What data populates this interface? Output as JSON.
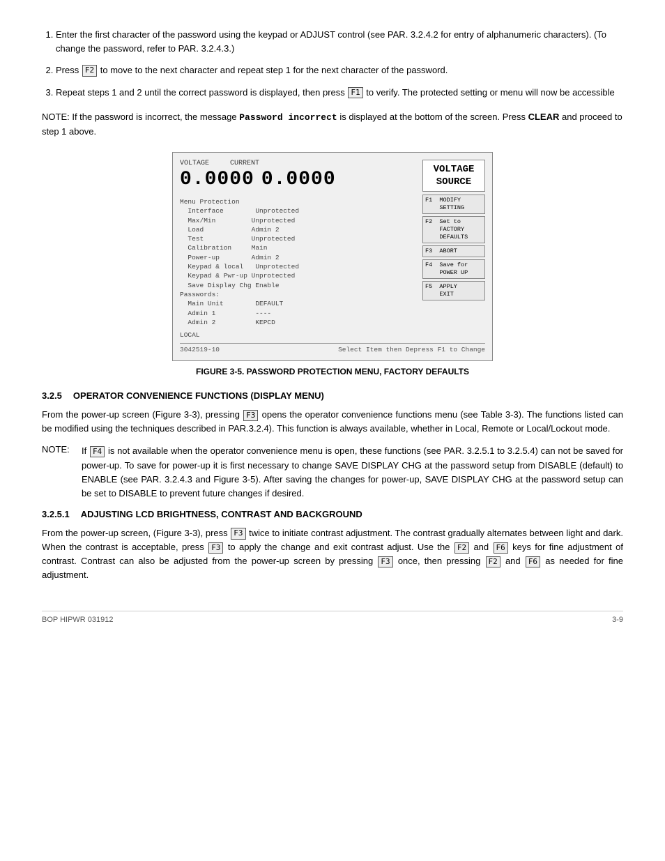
{
  "page": {
    "footer_left": "BOP HIPWR 031912",
    "footer_right": "3-9"
  },
  "steps": [
    {
      "number": "1",
      "text": "Enter the first character of the password using the keypad or ADJUST control (see PAR. 3.2.4.2 for entry of alphanumeric characters). (To change the password, refer to PAR. 3.2.4.3.)"
    },
    {
      "number": "2",
      "text_before": "Press",
      "key": "F2",
      "text_after": "to move to the next character and repeat step 1 for the next character of the password."
    },
    {
      "number": "3",
      "text_before": "Repeat steps 1 and 2 until the correct password is displayed, then press",
      "key": "F1",
      "text_after": "to verify. The protected setting or menu will now be accessible"
    }
  ],
  "note1": {
    "label": "NOTE:",
    "text_before": "If the password is incorrect, the message",
    "code": "Password  incorrect",
    "text_after": "is displayed at the bottom of the screen. Press",
    "bold": "CLEAR",
    "text_end": "and proceed to step 1 above."
  },
  "device": {
    "voltage_label": "VOLTAGE",
    "current_label": "CURRENT",
    "voltage_value": "0.0000",
    "current_value": "0.0000",
    "title": "VOLTAGE\nSOURCE",
    "menu_lines": [
      "Menu Protection",
      "  Interface        Unprotected",
      "  Max/Min          Unprotected",
      "  Load             Admin 2",
      "  Test             Unprotected",
      "  Calibration      Main",
      "  Power-up         Admin 2",
      "  Keypad & local   Unprotected",
      "  Keypad & Pwr-up  Unprotected",
      "  Save Display Chg  Enable",
      "Passwords:",
      "  Main Unit         DEFAULT",
      "  Admin 1           ----",
      "  Admin 2           KEPCD"
    ],
    "local_label": "LOCAL",
    "figure_number": "3042519-10",
    "footer_text": "Select Item then Depress F1 to Change",
    "fn_buttons": [
      {
        "key": "F1",
        "label": "MODIFY\nSETTING"
      },
      {
        "key": "F2",
        "label": "Set to\nFACTORY\nDEFAULTS"
      },
      {
        "key": "F3",
        "label": "ABORT"
      },
      {
        "key": "F4",
        "label": "Save for\nPOWER UP"
      },
      {
        "key": "F5",
        "label": "APPLY\nEXIT"
      }
    ]
  },
  "figure_caption": "FIGURE 3-5.   PASSWORD PROTECTION MENU, FACTORY DEFAULTS",
  "section_325": {
    "number": "3.2.5",
    "title": "OPERATOR CONVENIENCE FUNCTIONS (DISPLAY MENU)",
    "paragraph": "From the power-up screen (Figure 3-3), pressing",
    "key": "F3",
    "paragraph_after": "opens the operator convenience functions menu (see Table 3-3). The functions listed can be modified using the techniques described in PAR.3.2.4). This function is always available, whether in Local, Remote or Local/Lockout mode."
  },
  "note2": {
    "label": "NOTE:",
    "indent": "If",
    "key": "F4",
    "text": "is not available when the operator convenience menu is open, these functions (see PAR. 3.2.5.1 to 3.2.5.4) can not be saved for power-up. To save for power-up it is first necessary to change SAVE DISPLAY CHG at the password setup from DISABLE (default) to ENABLE (see PAR. 3.2.4.3 and Figure 3-5). After saving the changes for power-up, SAVE DISPLAY CHG at the password setup can be set to DISABLE to prevent future changes if desired."
  },
  "section_3251": {
    "number": "3.2.5.1",
    "title": "ADJUSTING LCD BRIGHTNESS, CONTRAST AND BACKGROUND",
    "paragraph1_before": "From the power-up screen, (Figure 3-3), press",
    "key1": "F3",
    "paragraph1_mid": "twice to initiate contrast adjustment. The contrast gradually alternates between light and dark. When the contrast is acceptable, press",
    "key2": "F3",
    "paragraph1_after": "to apply the change and exit contrast adjust. Use the",
    "key3": "F2",
    "paragraph1_and": "and",
    "key4": "F6",
    "paragraph1_end": "keys for fine adjustment of contrast. Contrast can also be adjusted from the power-up screen by pressing",
    "key5": "F3",
    "paragraph1_last": "once, then pressing",
    "key6": "F2",
    "paragraph1_final_and": "and",
    "key7": "F6",
    "paragraph1_final": "as needed for fine adjustment."
  }
}
